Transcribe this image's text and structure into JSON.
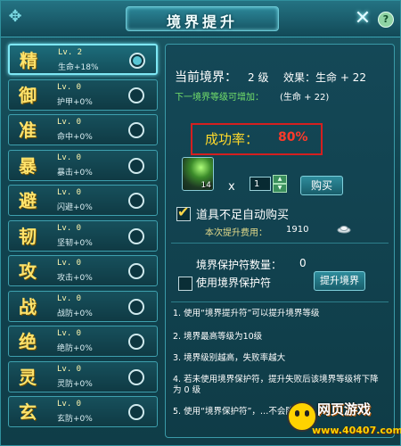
{
  "window": {
    "title": "境界提升",
    "close_icon": "close-icon"
  },
  "left_list": [
    {
      "char": "精",
      "lv": "Lv. 2",
      "attr": "生命+18%",
      "selected": true
    },
    {
      "char": "御",
      "lv": "Lv. 0",
      "attr": "护甲+0%",
      "selected": false
    },
    {
      "char": "准",
      "lv": "Lv. 0",
      "attr": "命中+0%",
      "selected": false
    },
    {
      "char": "暴",
      "lv": "Lv. 0",
      "attr": "暴击+0%",
      "selected": false
    },
    {
      "char": "避",
      "lv": "Lv. 0",
      "attr": "闪避+0%",
      "selected": false
    },
    {
      "char": "韧",
      "lv": "Lv. 0",
      "attr": "坚韧+0%",
      "selected": false
    },
    {
      "char": "攻",
      "lv": "Lv. 0",
      "attr": "攻击+0%",
      "selected": false
    },
    {
      "char": "战",
      "lv": "Lv. 0",
      "attr": "战防+0%",
      "selected": false
    },
    {
      "char": "绝",
      "lv": "Lv. 0",
      "attr": "绝防+0%",
      "selected": false
    },
    {
      "char": "灵",
      "lv": "Lv. 0",
      "attr": "灵防+0%",
      "selected": false
    },
    {
      "char": "玄",
      "lv": "Lv. 0",
      "attr": "玄防+0%",
      "selected": false
    }
  ],
  "right": {
    "current_label": "当前境界：",
    "current_value": "2 级",
    "effect": "效果：生命 + 22",
    "next_hint": "下一境界等级可增加：",
    "next_bonus": "(生命 + 22)",
    "rate_label": "成功率：",
    "rate_value": "80%",
    "item_count": "14",
    "times": "x",
    "qty_value": "1",
    "buy_label": "购买",
    "auto_buy_label": "道具不足自动购买",
    "auto_buy_checked": true,
    "cost_label": "本次提升费用：",
    "cost_value": "1910",
    "guard_count_label": "境界保护符数量：",
    "guard_count_value": "0",
    "guard_use_label": "使用境界保护符",
    "upgrade_label": "提升境界",
    "notes": [
      "1. 使用“境界提升符”可以提升境界等级",
      "2. 境界最高等级为10级",
      "3. 境界级别越高，失败率越大",
      "4. 若未使用境界保护符，提升失败后该境界等级将下降为 0 级",
      "5. 使用“境界保护符”，…不会降级"
    ]
  },
  "watermark": {
    "cn": "网页游戏",
    "url": "www.40407.com"
  }
}
